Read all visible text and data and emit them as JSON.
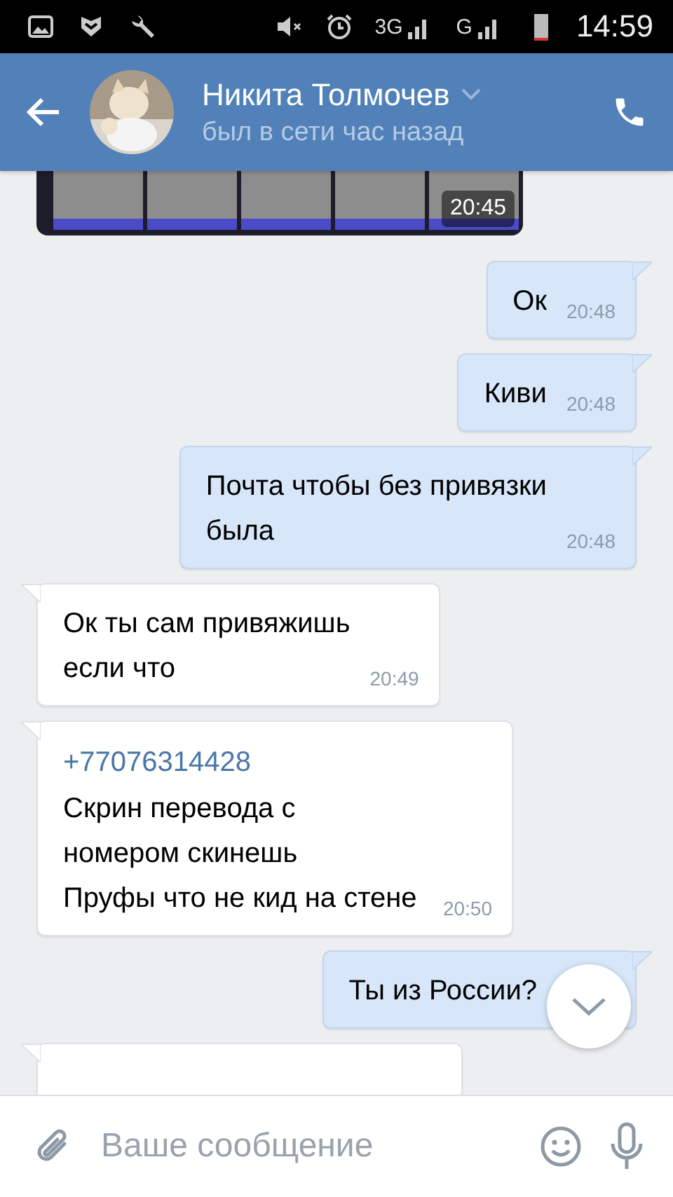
{
  "status_bar": {
    "network_1": "3G",
    "network_2": "G",
    "time": "14:59"
  },
  "header": {
    "name": "Никита Толмочев",
    "status": "был в сети час назад"
  },
  "messages": [
    {
      "time": "20:45"
    },
    {
      "kind": "outgoing",
      "text": "Ок",
      "time": "20:48"
    },
    {
      "kind": "outgoing",
      "text": "Киви",
      "time": "20:48"
    },
    {
      "kind": "outgoing",
      "text": "Почта чтобы без привязки\nбыла",
      "time": "20:48"
    },
    {
      "kind": "incoming",
      "text": "Ок ты сам привяжишь\nесли что",
      "time": "20:49"
    },
    {
      "kind": "incoming",
      "link": "+77076314428",
      "text": "Скрин перевода с\nномером скинешь\nПруфы что не кид на стене",
      "time": "20:50"
    },
    {
      "kind": "outgoing",
      "text": "Ты из России?"
    },
    {
      "kind": "incoming"
    }
  ],
  "composer": {
    "placeholder": "Ваше сообщение"
  }
}
